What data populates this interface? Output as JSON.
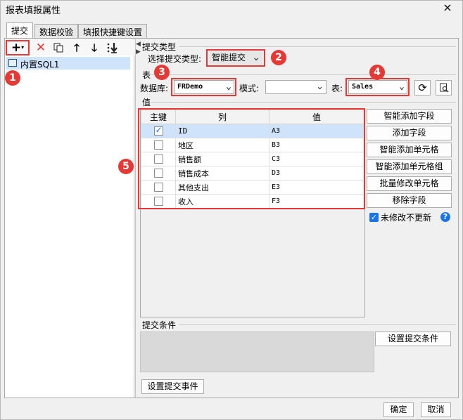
{
  "window": {
    "title": "报表填报属性",
    "close_symbol": "×"
  },
  "tabs": [
    {
      "label": "提交",
      "active": true
    },
    {
      "label": "数据校验",
      "active": false
    },
    {
      "label": "填报快捷键设置",
      "active": false
    }
  ],
  "left": {
    "toolbar_icons": [
      "add-dropdown-icon",
      "delete-icon",
      "copy-icon",
      "move-up-icon",
      "move-down-icon",
      "move-bottom-icon"
    ],
    "tree_item": "内置SQL1"
  },
  "badges": [
    "1",
    "2",
    "3",
    "4",
    "5"
  ],
  "submit_type": {
    "section_label": "提交类型",
    "select_label": "选择提交类型:",
    "value": "智能提交"
  },
  "table_section": {
    "section_label": "表",
    "db_label": "数据库:",
    "db_value": "FRDemo",
    "mode_label": "模式:",
    "mode_value": "",
    "table_label": "表:",
    "table_value": "Sales"
  },
  "values_section": {
    "section_label": "值",
    "columns": [
      "主键",
      "列",
      "值"
    ],
    "rows": [
      {
        "key": true,
        "column": "ID",
        "value": "A3"
      },
      {
        "key": false,
        "column": "地区",
        "value": "B3"
      },
      {
        "key": false,
        "column": "销售额",
        "value": "C3"
      },
      {
        "key": false,
        "column": "销售成本",
        "value": "D3"
      },
      {
        "key": false,
        "column": "其他支出",
        "value": "E3"
      },
      {
        "key": false,
        "column": "收入",
        "value": "F3"
      }
    ],
    "buttons": [
      "智能添加字段",
      "添加字段",
      "智能添加单元格",
      "智能添加单元格组",
      "批量修改单元格",
      "移除字段"
    ],
    "unmodified_checkbox": {
      "label": "未修改不更新",
      "checked": true
    }
  },
  "condition": {
    "section_label": "提交条件",
    "button": "设置提交条件"
  },
  "event_button": "设置提交事件",
  "footer": {
    "ok": "确定",
    "cancel": "取消"
  },
  "colors": {
    "highlight_red": "#e53935",
    "selection_blue": "#cfe3fa",
    "help_blue": "#1a73e8"
  }
}
